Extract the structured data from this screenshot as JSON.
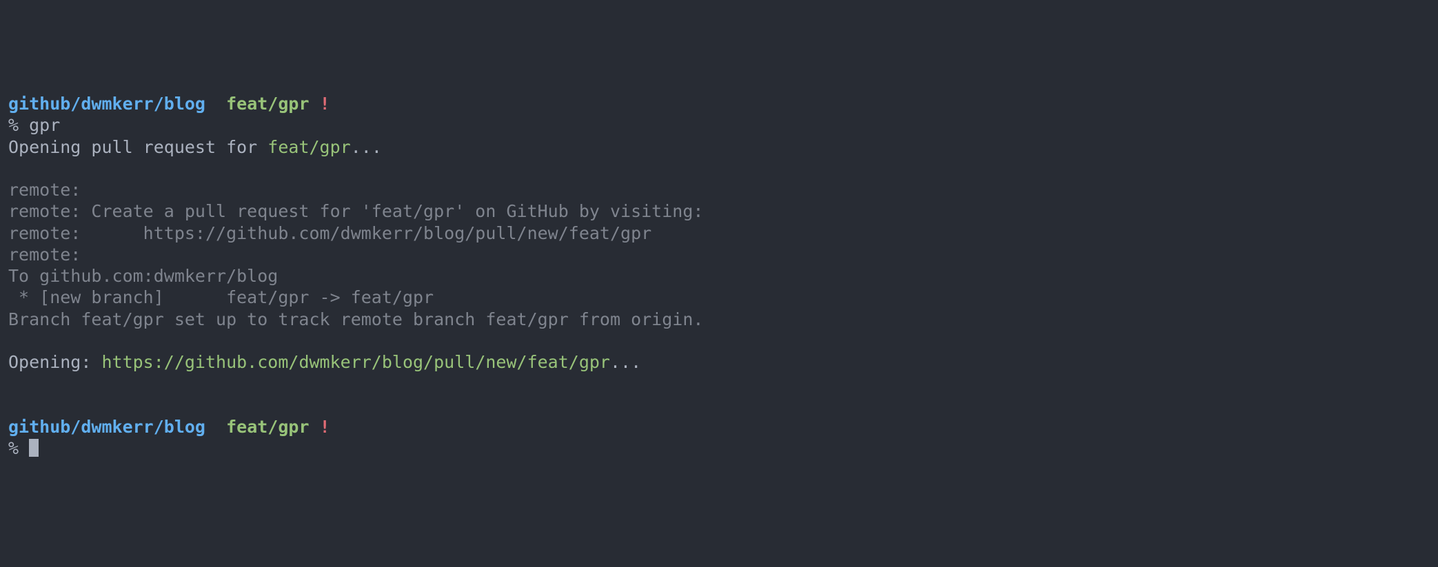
{
  "prompt1": {
    "path": "github/dwmkerr/blog",
    "branch": "feat/gpr",
    "dirty": "!",
    "symbol": "%",
    "command": "gpr"
  },
  "output": {
    "l1_prefix": "Opening pull request for ",
    "l1_branch": "feat/gpr",
    "l1_suffix": "...",
    "blank1": "",
    "l2": "remote:",
    "l3": "remote: Create a pull request for 'feat/gpr' on GitHub by visiting:",
    "l4": "remote:      https://github.com/dwmkerr/blog/pull/new/feat/gpr",
    "l5": "remote:",
    "l6": "To github.com:dwmkerr/blog",
    "l7": " * [new branch]      feat/gpr -> feat/gpr",
    "l8": "Branch feat/gpr set up to track remote branch feat/gpr from origin.",
    "blank2": "",
    "l9_prefix": "Opening: ",
    "l9_url": "https://github.com/dwmkerr/blog/pull/new/feat/gpr",
    "l9_suffix": "...",
    "blank3": "",
    "blank4": ""
  },
  "prompt2": {
    "path": "github/dwmkerr/blog",
    "branch": "feat/gpr",
    "dirty": "!",
    "symbol": "%"
  }
}
